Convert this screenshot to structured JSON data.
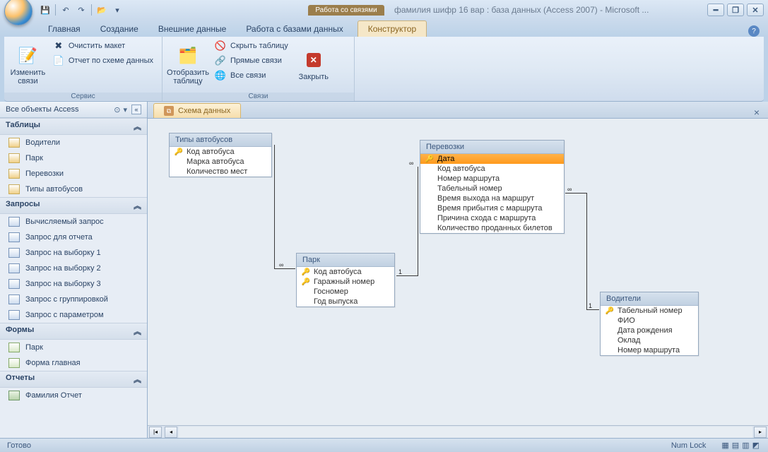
{
  "qat": {
    "save": "💾",
    "undo": "↶",
    "redo": "↷",
    "open": "📂"
  },
  "title": {
    "context_label": "Работа со связями",
    "text": "фамилия шифр 16 вар : база данных (Access 2007) - Microsoft ..."
  },
  "ribbon_tabs": {
    "home": "Главная",
    "create": "Создание",
    "external": "Внешние данные",
    "dbtools": "Работа с базами данных",
    "ctx": "Конструктор"
  },
  "ribbon": {
    "group_service": "Сервис",
    "group_links": "Связи",
    "edit_rel": "Изменить связи",
    "clear_layout": "Очистить макет",
    "schema_report": "Отчет по схеме данных",
    "show_table": "Отобразить таблицу",
    "hide_table": "Скрыть таблицу",
    "direct_rel": "Прямые связи",
    "all_rel": "Все связи",
    "close": "Закрыть"
  },
  "nav": {
    "title": "Все объекты Access",
    "g_tables": "Таблицы",
    "g_queries": "Запросы",
    "g_forms": "Формы",
    "g_reports": "Отчеты",
    "tables": [
      "Водители",
      "Парк",
      "Перевозки",
      "Типы автобусов"
    ],
    "queries": [
      "Вычисляемый запрос",
      "Запрос для отчета",
      "Запрос на выборку 1",
      "Запрос на выборку 2",
      "Запрос на выборку 3",
      "Запрос с группировкой",
      "Запрос с параметром"
    ],
    "forms": [
      "Парк",
      "Форма главная"
    ],
    "reports": [
      "Фамилия Отчет"
    ]
  },
  "doc_tab": "Схема данных",
  "tables": {
    "bus_types": {
      "title": "Типы автобусов",
      "fields": [
        "Код автобуса",
        "Марка автобуса",
        "Количество мест"
      ],
      "keys": [
        0
      ]
    },
    "park": {
      "title": "Парк",
      "fields": [
        "Код автобуса",
        "Гаражный номер",
        "Госномер",
        "Год выпуска"
      ],
      "keys": [
        0,
        1
      ]
    },
    "trans": {
      "title": "Перевозки",
      "fields": [
        "Дата",
        "Код автобуса",
        "Номер маршрута",
        "Табельный номер",
        "Время выхода на маршрут",
        "Время прибытия с маршрута",
        "Причина схода с маршрута",
        "Количество проданных билетов"
      ],
      "keys": [
        0
      ],
      "selected": 0
    },
    "drivers": {
      "title": "Водители",
      "fields": [
        "Табельный номер",
        "ФИО",
        "Дата рождения",
        "Оклад",
        "Номер маршрута"
      ],
      "keys": [
        0
      ]
    }
  },
  "status": {
    "ready": "Готово",
    "numlock": "Num Lock"
  }
}
